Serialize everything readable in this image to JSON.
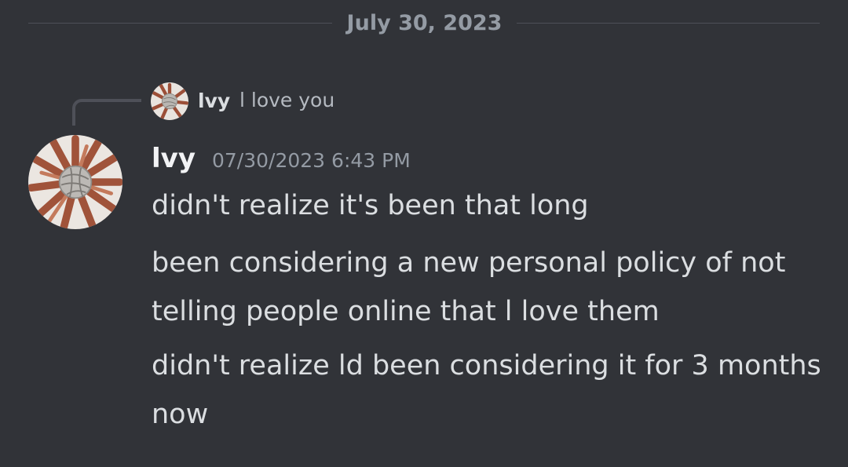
{
  "divider": {
    "date": "July 30, 2023"
  },
  "reply": {
    "author": "lvy",
    "text": "l love you",
    "avatar_icon": "yarn-ball-hands-avatar"
  },
  "message_group": {
    "author": "lvy",
    "timestamp": "07/30/2023 6:43 PM",
    "avatar_icon": "yarn-ball-hands-avatar",
    "messages": [
      "didn't realize it's been that long",
      "been considering a new personal policy of not telling people online that l love them",
      "didn't realize ld been considering it for 3 months now"
    ]
  },
  "colors": {
    "background": "#313338",
    "divider": "#4e5058",
    "muted_text": "#949ba4",
    "author_text": "#f2f3f5",
    "message_text": "#dbdee1"
  }
}
